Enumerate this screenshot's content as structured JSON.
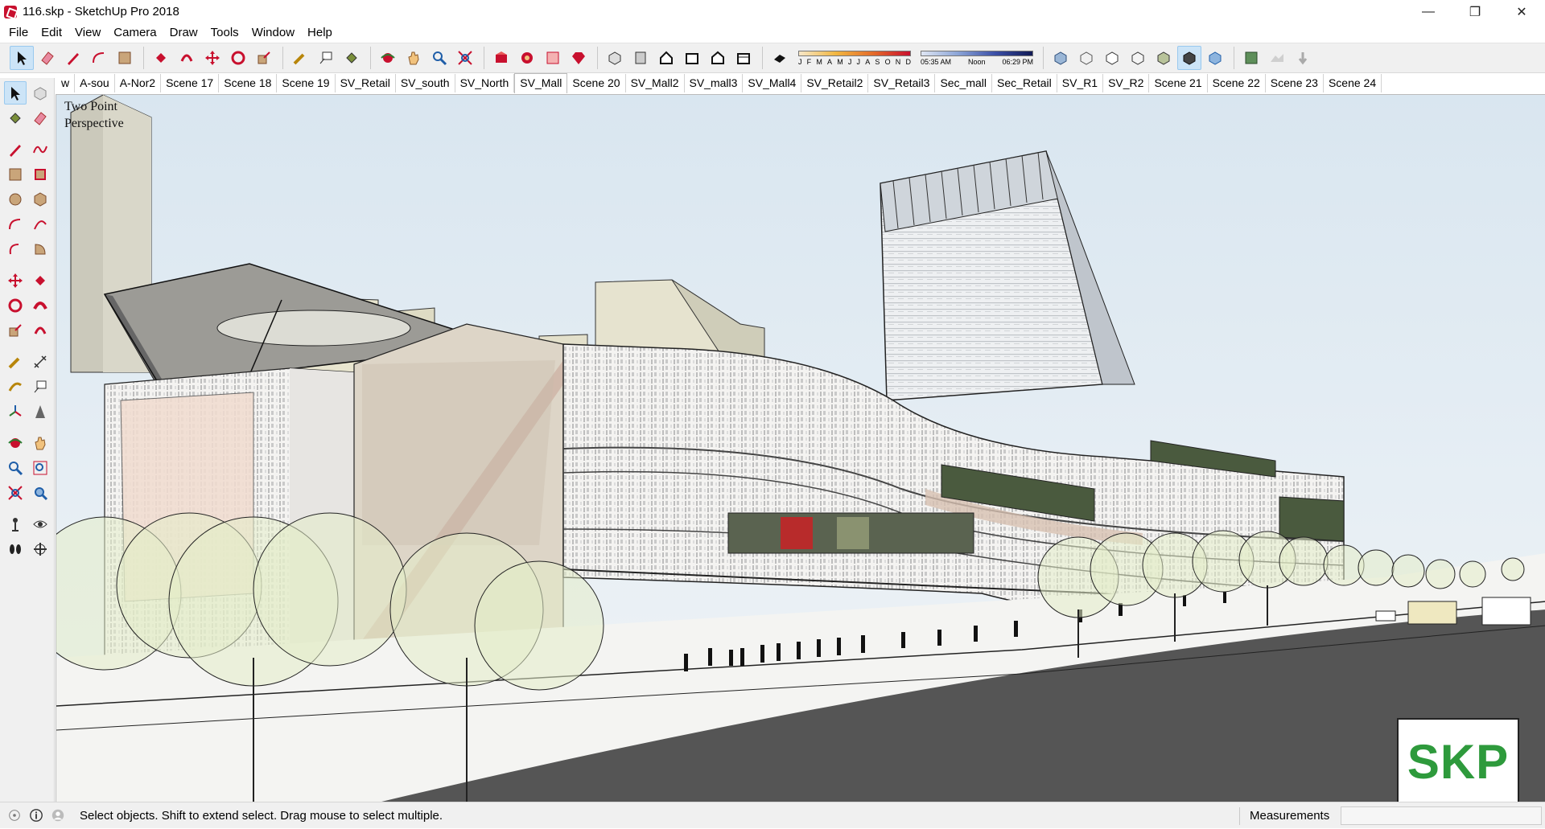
{
  "window": {
    "title": "116.skp - SketchUp Pro 2018",
    "icon": "sketchup-icon",
    "controls": [
      "minimize-icon",
      "restore-icon",
      "close-icon"
    ]
  },
  "menus": [
    "File",
    "Edit",
    "View",
    "Camera",
    "Draw",
    "Tools",
    "Window",
    "Help"
  ],
  "shadows": {
    "months": [
      "J",
      "F",
      "M",
      "A",
      "M",
      "J",
      "J",
      "A",
      "S",
      "O",
      "N",
      "D"
    ],
    "time_start": "05:35 AM",
    "time_mid": "Noon",
    "time_end": "06:29 PM"
  },
  "scene_tabs": [
    "w",
    "A-sou",
    "A-Nor2",
    "Scene 17",
    "Scene 18",
    "Scene 19",
    "SV_Retail",
    "SV_south",
    "SV_North",
    "SV_Mall",
    "Scene 20",
    "SV_Mall2",
    "SV_mall3",
    "SV_Mall4",
    "SV_Retail2",
    "SV_Retail3",
    "Sec_mall",
    "Sec_Retail",
    "SV_R1",
    "SV_R2",
    "Scene 21",
    "Scene 22",
    "Scene 23",
    "Scene 24"
  ],
  "active_scene": "SV_Mall",
  "viewport": {
    "camera_label": "Two Point Perspective",
    "logo_text": "SKP",
    "logo_color": "#2e9a3c"
  },
  "status": {
    "text": "Select objects. Shift to extend select. Drag mouse to select multiple.",
    "measurements_label": "Measurements"
  },
  "colors": {
    "accent_selected": "#cce4f7",
    "toolbar_bg": "#f0f0f0",
    "sketchup_red": "#c8102e"
  }
}
